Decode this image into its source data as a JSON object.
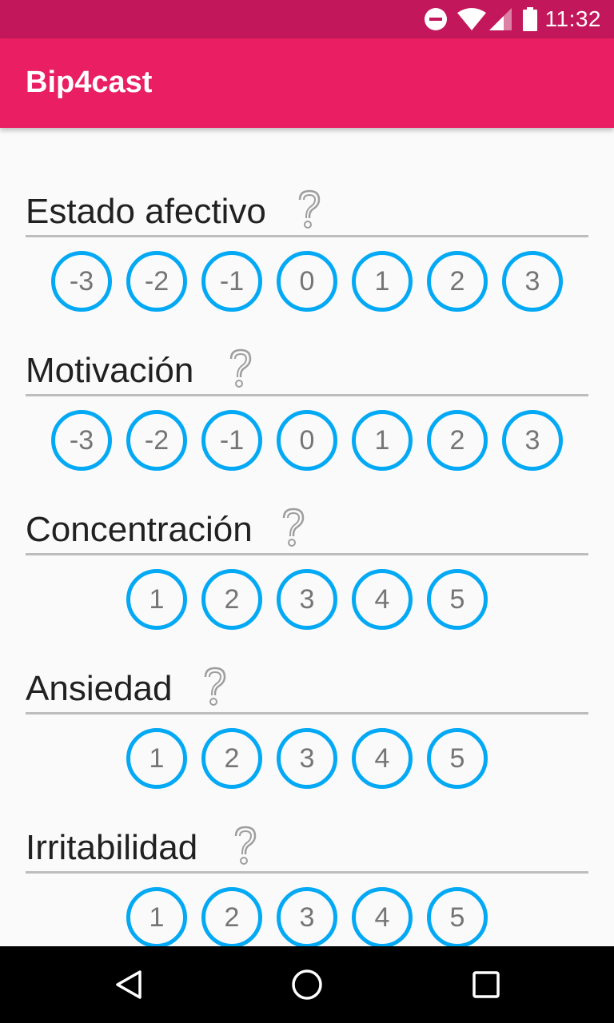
{
  "status_bar": {
    "time": "11:32",
    "icons": [
      "do-not-disturb-icon",
      "wifi-icon",
      "signal-icon",
      "battery-icon"
    ],
    "color": "#c2185b"
  },
  "app_bar": {
    "title": "Bip4cast",
    "color": "#e91e63"
  },
  "accent_color": "#03a9f4",
  "sections": [
    {
      "title": "Estado afectivo",
      "options": [
        "-3",
        "-2",
        "-1",
        "0",
        "1",
        "2",
        "3"
      ]
    },
    {
      "title": "Motivación",
      "options": [
        "-3",
        "-2",
        "-1",
        "0",
        "1",
        "2",
        "3"
      ]
    },
    {
      "title": "Concentración",
      "options": [
        "1",
        "2",
        "3",
        "4",
        "5"
      ]
    },
    {
      "title": "Ansiedad",
      "options": [
        "1",
        "2",
        "3",
        "4",
        "5"
      ]
    },
    {
      "title": "Irritabilidad",
      "options": [
        "1",
        "2",
        "3",
        "4",
        "5"
      ]
    }
  ],
  "nav_bar": {
    "buttons": [
      "back-icon",
      "home-icon",
      "recents-icon"
    ]
  }
}
